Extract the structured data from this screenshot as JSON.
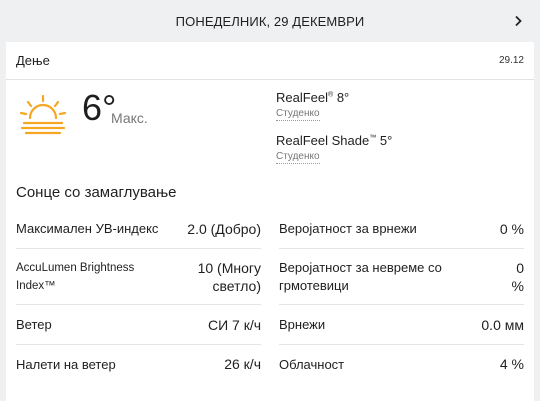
{
  "date_bar": {
    "label": "ПОНЕДЕЛНИК, 29 ДЕКЕМВРИ"
  },
  "card": {
    "title": "Дење",
    "date": "29.12"
  },
  "current": {
    "temperature": "6°",
    "temp_label": "Макс.",
    "realfeel_label": "RealFeel",
    "realfeel_value": "8°",
    "realfeel_desc": "Студенко",
    "realfeel_shade_label": "RealFeel Shade",
    "realfeel_shade_value": "5°",
    "realfeel_shade_desc": "Студенко",
    "phrase": "Сонце со замаглување"
  },
  "details_left": [
    {
      "label": "Максимален УВ-индекс",
      "value": "2.0 (Добро)"
    },
    {
      "label": "AccuLumen Brightness Index™",
      "value": "10 (Многу светло)"
    },
    {
      "label": "Ветер",
      "value": "СИ 7 к/ч"
    },
    {
      "label": "Налети на ветер",
      "value": "26 к/ч"
    }
  ],
  "details_right": [
    {
      "label": "Веројатност за врнежи",
      "value": "0 %"
    },
    {
      "label": "Веројатност за невреме со грмотевици",
      "value": "0 %"
    },
    {
      "label": "Врнежи",
      "value": "0.0 мм"
    },
    {
      "label": "Облачност",
      "value": "4 %"
    }
  ],
  "icons": {
    "weather": "sun-haze-icon",
    "nav": "chevron-right-icon"
  },
  "colors": {
    "sun": "#f5a623",
    "haze": "#f5a623"
  }
}
